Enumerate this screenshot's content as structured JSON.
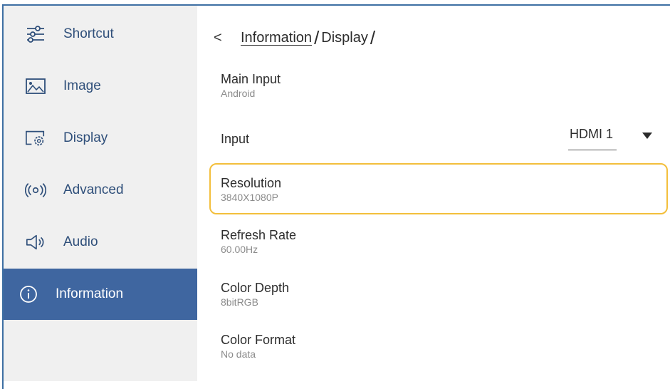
{
  "sidebar": {
    "items": [
      {
        "label": "Shortcut",
        "icon": "sliders-icon"
      },
      {
        "label": "Image",
        "icon": "image-icon"
      },
      {
        "label": "Display",
        "icon": "display-settings-icon"
      },
      {
        "label": "Advanced",
        "icon": "broadcast-icon"
      },
      {
        "label": "Audio",
        "icon": "speaker-icon"
      },
      {
        "label": "Information",
        "icon": "info-icon",
        "active": true
      }
    ]
  },
  "breadcrumb": {
    "back": "<",
    "parent": "Information",
    "separator": "/",
    "current": "Display"
  },
  "settings": {
    "main_input": {
      "title": "Main Input",
      "value": "Android"
    },
    "input": {
      "title": "Input",
      "selected": "HDMI 1"
    },
    "resolution": {
      "title": "Resolution",
      "value": "3840X1080P"
    },
    "refresh_rate": {
      "title": "Refresh Rate",
      "value": "60.00Hz"
    },
    "color_depth": {
      "title": "Color Depth",
      "value": "8bitRGB"
    },
    "color_format": {
      "title": "Color Format",
      "value": "No data"
    }
  },
  "colors": {
    "accent": "#3f66a0",
    "focus": "#f3bf3c",
    "nav_text": "#2f4f7a"
  }
}
